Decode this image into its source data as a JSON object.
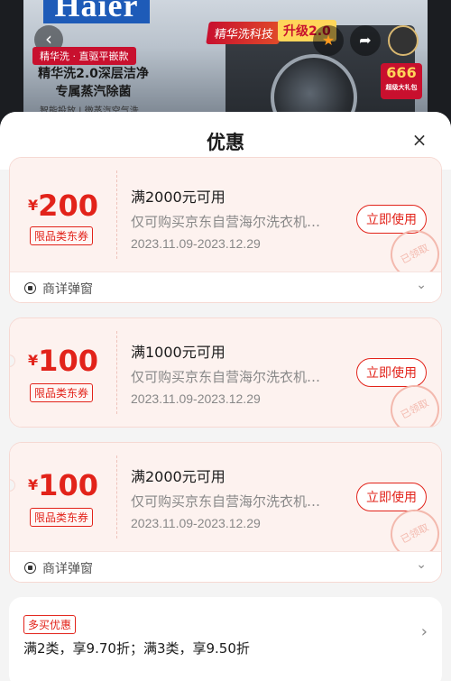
{
  "banner": {
    "brand": "Haier",
    "tagline": "精华洗 · 直驱平嵌款",
    "headline": "精华洗2.0深层洁净专属蒸汽除菌",
    "subline": "智能投放 | 微蒸汽空气洗",
    "tech_badge": "精华洗科技",
    "upgrade_badge": "升级2.0",
    "promo_number": "666",
    "promo_sub": "超级大礼包"
  },
  "sheet": {
    "title": "优惠"
  },
  "coupons": [
    {
      "currency": "¥",
      "amount": "200",
      "limit_tag": "限品类东券",
      "threshold": "满2000元可用",
      "scope": "仅可购买京东自营海尔洗衣机…",
      "validity": "2023.11.09-2023.12.29",
      "button": "立即使用",
      "stamp": "已领取",
      "footer": "商详弹窗"
    },
    {
      "currency": "¥",
      "amount": "100",
      "limit_tag": "限品类东券",
      "threshold": "满1000元可用",
      "scope": "仅可购买京东自营海尔洗衣机…",
      "validity": "2023.11.09-2023.12.29",
      "button": "立即使用",
      "stamp": "已领取"
    },
    {
      "currency": "¥",
      "amount": "100",
      "limit_tag": "限品类东券",
      "threshold": "满2000元可用",
      "scope": "仅可购买京东自营海尔洗衣机…",
      "validity": "2023.11.09-2023.12.29",
      "button": "立即使用",
      "stamp": "已领取",
      "footer": "商详弹窗"
    }
  ],
  "multi_buy": {
    "tag": "多买优惠",
    "text": "满2类，享9.70折；满3类，享9.50折"
  },
  "colors": {
    "accent": "#e2231a",
    "card_bg": "#fdf2ef"
  },
  "icons": {
    "back": "back-icon",
    "favorite": "star-icon",
    "share": "share-icon",
    "close": "close-icon",
    "chevron_down": "chevron-down-icon",
    "chevron_right": "chevron-right-icon"
  }
}
